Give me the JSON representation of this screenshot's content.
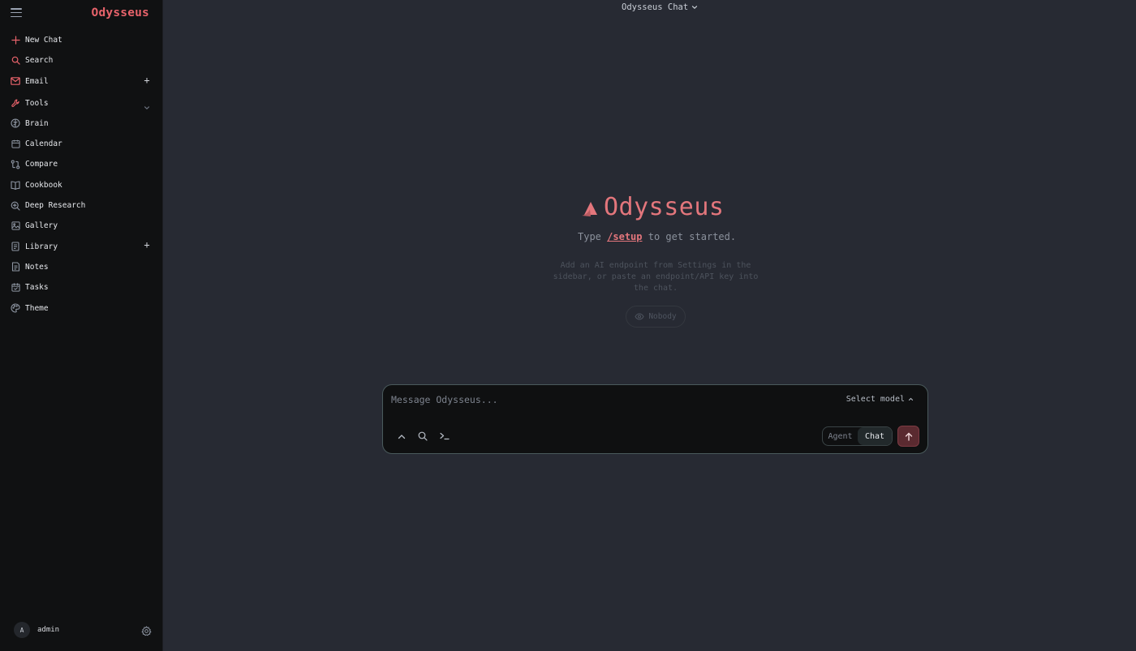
{
  "sidebar": {
    "brand": "Odysseus",
    "items": [
      {
        "label": "New Chat",
        "icon": "plus-icon"
      },
      {
        "label": "Search",
        "icon": "search-icon"
      },
      {
        "label": "Email",
        "icon": "mail-icon",
        "action": "+"
      },
      {
        "label": "Tools",
        "icon": "wrench-icon"
      },
      {
        "label": "Brain",
        "icon": "brain-icon"
      },
      {
        "label": "Calendar",
        "icon": "calendar-icon"
      },
      {
        "label": "Compare",
        "icon": "compare-icon"
      },
      {
        "label": "Cookbook",
        "icon": "book-icon"
      },
      {
        "label": "Deep Research",
        "icon": "research-icon"
      },
      {
        "label": "Gallery",
        "icon": "image-icon"
      },
      {
        "label": "Library",
        "icon": "library-icon",
        "action": "+"
      },
      {
        "label": "Notes",
        "icon": "notes-icon"
      },
      {
        "label": "Tasks",
        "icon": "tasks-icon"
      },
      {
        "label": "Theme",
        "icon": "palette-icon"
      }
    ],
    "user": {
      "initial": "A",
      "name": "admin"
    }
  },
  "header": {
    "model_title": "Odysseus Chat"
  },
  "hero": {
    "title": "Odysseus",
    "hint_prefix": "Type",
    "hint_cmd": "/setup",
    "hint_suffix": "to get started.",
    "info": "Add an AI endpoint from Settings in the sidebar, or paste an endpoint/API key into the chat.",
    "visibility": "Nobody"
  },
  "composer": {
    "placeholder": "Message Odysseus...",
    "select_model": "Select model",
    "modes": [
      "Agent",
      "Chat"
    ],
    "active_mode": "Chat"
  },
  "colors": {
    "accent": "#e8636b",
    "sidebar_bg": "#101112",
    "main_bg": "#272a33"
  }
}
